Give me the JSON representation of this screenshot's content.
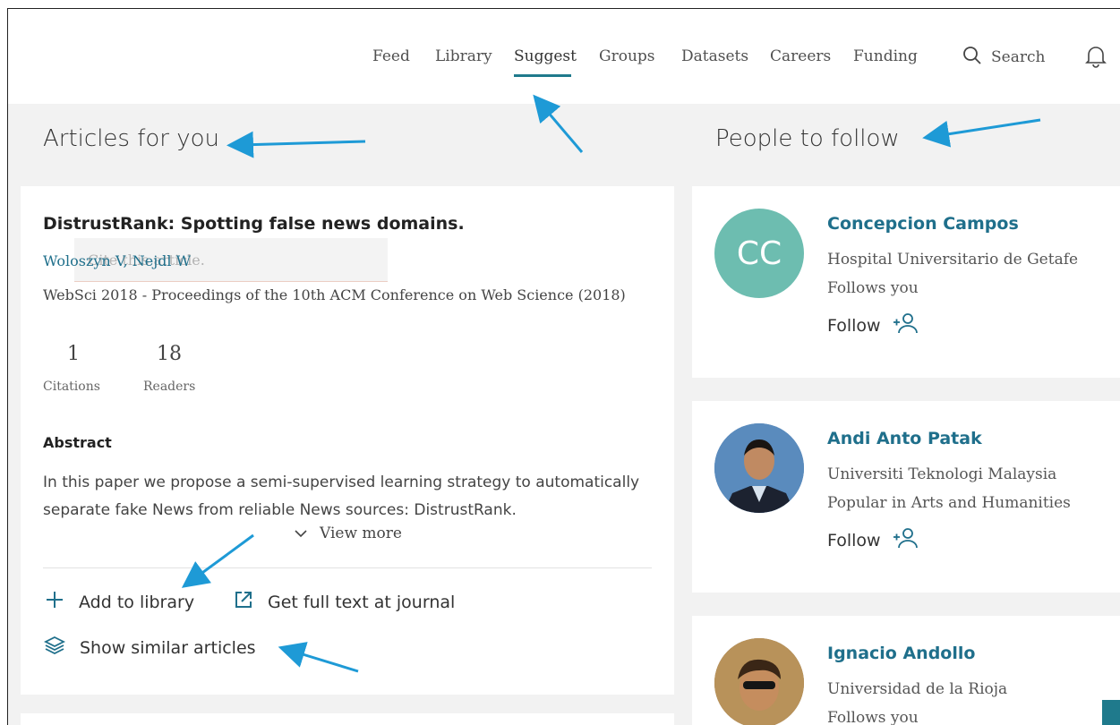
{
  "nav": {
    "items": [
      {
        "label": "Feed"
      },
      {
        "label": "Library"
      },
      {
        "label": "Suggest"
      },
      {
        "label": "Groups"
      },
      {
        "label": "Datasets"
      },
      {
        "label": "Careers"
      },
      {
        "label": "Funding"
      }
    ],
    "active": "Suggest",
    "search_label": "Search"
  },
  "articles": {
    "section_title": "Articles for you",
    "article": {
      "title": "DistrustRank: Spotting false news domains.",
      "authors": "Woloszyn V, Nejdl W",
      "ghost_text": "Cite this article.",
      "venue": "WebSci 2018 - Proceedings of the 10th ACM Conference on Web Science (2018)",
      "citations": "1",
      "citations_label": "Citations",
      "readers": "18",
      "readers_label": "Readers",
      "abstract_heading": "Abstract",
      "abstract_text": "In this paper we propose a semi-supervised learning strategy to automatically separate fake News from reliable News sources: DistrustRank.",
      "view_more": "View more",
      "add_to_library": "Add to library",
      "full_text": "Get full text at journal",
      "similar": "Show similar articles"
    }
  },
  "people": {
    "section_title": "People to follow",
    "follow_label": "Follow",
    "list": [
      {
        "initials": "CC",
        "name": "Concepcion Campos",
        "affiliation": "Hospital Universitario de Getafe",
        "note": "Follows you"
      },
      {
        "name": "Andi Anto Patak",
        "affiliation": "Universiti Teknologi Malaysia",
        "note": "Popular in Arts and Humanities"
      },
      {
        "name": "Ignacio Andollo",
        "affiliation": "Universidad de la Rioja",
        "note": "Follows you"
      }
    ]
  },
  "colors": {
    "accent": "#1f7a8c",
    "link": "#1f6f8b",
    "annotation_arrow": "#1e9ad6",
    "avatar_cc": "#6dbdb0"
  }
}
